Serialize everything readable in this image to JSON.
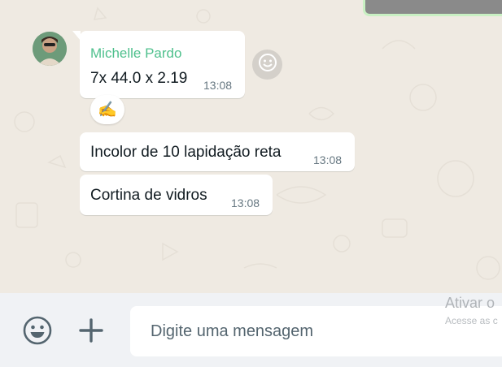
{
  "messages": [
    {
      "sender": "Michelle Pardo",
      "text": "7x 44.0 x 2.19",
      "time": "13:08",
      "reaction": "✍️"
    },
    {
      "text": "Incolor de 10 lapidação reta",
      "time": "13:08"
    },
    {
      "text": "Cortina de vidros",
      "time": "13:08"
    }
  ],
  "footer": {
    "emoji_icon": "emoji-icon",
    "attach_icon": "plus-icon",
    "input_placeholder": "Digite uma mensagem"
  },
  "watermark": {
    "title": "Ativar o",
    "subtitle": "Acesse as c"
  },
  "colors": {
    "chat_bg": "#efeae2",
    "sender_name": "#4fc08d",
    "footer_bg": "#f0f2f5"
  }
}
